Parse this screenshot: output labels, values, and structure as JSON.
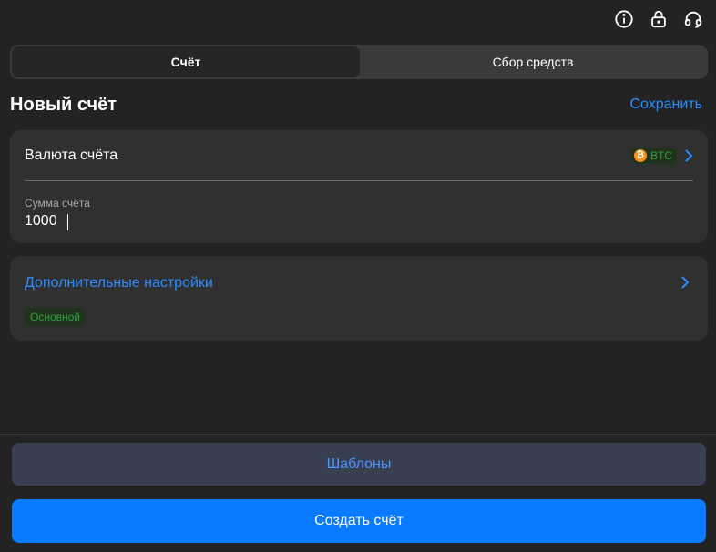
{
  "top_icons": [
    "info-icon",
    "lock-icon",
    "headset-icon"
  ],
  "tabs": [
    {
      "label": "Счёт",
      "active": true
    },
    {
      "label": "Сбор средств",
      "active": false
    }
  ],
  "header": {
    "title": "Новый счёт",
    "save_label": "Сохранить"
  },
  "currency": {
    "label": "Валюта счёта",
    "selected": "BTC",
    "coin_symbol": "₿"
  },
  "amount": {
    "label": "Сумма счёта",
    "value": "1000"
  },
  "settings": {
    "title": "Дополнительные настройки",
    "badge": "Основной"
  },
  "buttons": {
    "templates": "Шаблоны",
    "create": "Создать счёт"
  },
  "colors": {
    "background": "#232323",
    "card": "#303030",
    "accent": "#0a7bff",
    "link": "#2b8cff",
    "badge_text": "#2fa23a",
    "btc": "#f2931a"
  }
}
